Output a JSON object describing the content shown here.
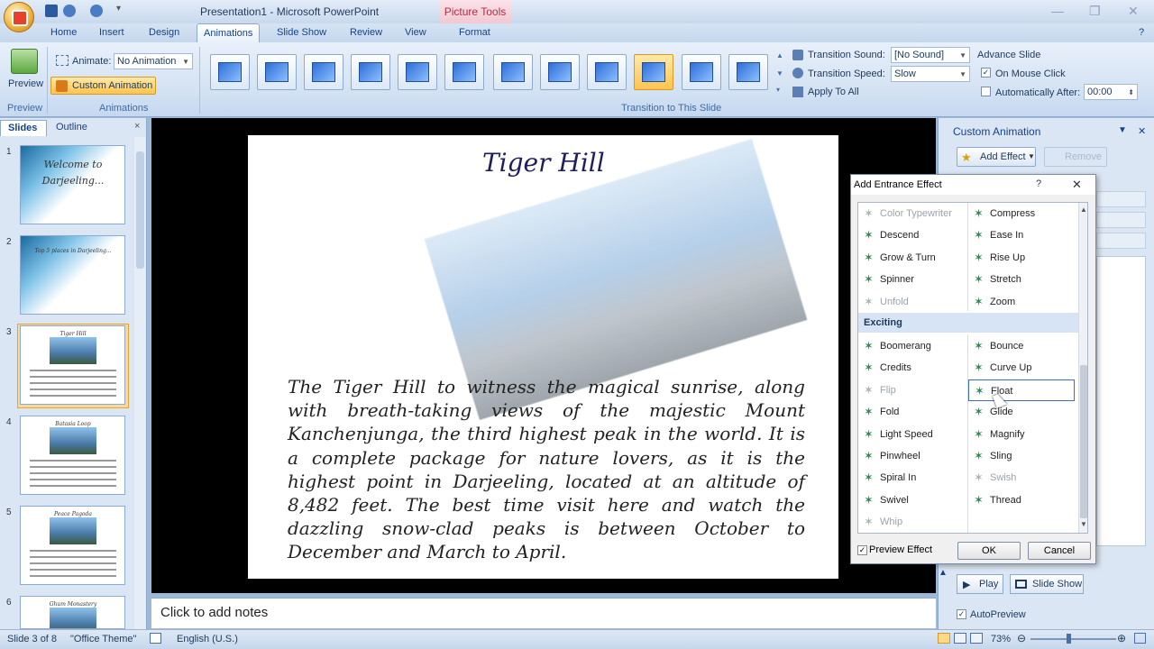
{
  "window": {
    "title": "Presentation1 - Microsoft PowerPoint",
    "contextual_tab": "Picture Tools"
  },
  "tabs": [
    "Home",
    "Insert",
    "Design",
    "Animations",
    "Slide Show",
    "Review",
    "View",
    "Format"
  ],
  "active_tab": "Animations",
  "ribbon": {
    "preview_label": "Preview",
    "preview_group": "Preview",
    "animate_label": "Animate:",
    "animate_value": "No Animation",
    "custom_animation_button": "Custom Animation",
    "animations_group": "Animations",
    "transition_group": "Transition to This Slide",
    "transition_sound_label": "Transition Sound:",
    "transition_sound_value": "[No Sound]",
    "transition_speed_label": "Transition Speed:",
    "transition_speed_value": "Slow",
    "apply_to_all": "Apply To All",
    "advance_slide": "Advance Slide",
    "on_mouse_click": "On Mouse Click",
    "on_mouse_click_checked": true,
    "automatically_after": "Automatically After:",
    "automatically_after_checked": false,
    "auto_time": "00:00",
    "selected_transition_index": 9
  },
  "left_pane": {
    "tabs": [
      "Slides",
      "Outline"
    ],
    "close": "×",
    "slides": [
      {
        "num": "1",
        "text": "Welcome to Darjeeling..."
      },
      {
        "num": "2",
        "text": "Top 5 places in Darjeeling..."
      },
      {
        "num": "3",
        "text": "Tiger Hill"
      },
      {
        "num": "4",
        "text": "Batasia Loop"
      },
      {
        "num": "5",
        "text": "Peace Pagoda"
      },
      {
        "num": "6",
        "text": "Ghum Monastery"
      }
    ],
    "selected_slide": "3"
  },
  "slide": {
    "title": "Tiger Hill",
    "body": "The Tiger Hill to witness the magical sunrise, along with breath-taking views of the majestic Mount Kanchenjunga, the third highest peak in the world. It is a complete package for nature lovers, as it is the highest point in Darjeeling, located at an altitude of 8,482 feet. The best time visit here and watch the dazzling snow-clad peaks is between October to December and March to April."
  },
  "notes_placeholder": "Click to add notes",
  "custom_animation_pane": {
    "title": "Custom Animation",
    "add_effect": "Add Effect",
    "remove": "Remove",
    "play": "Play",
    "slide_show": "Slide Show",
    "autopreview": "AutoPreview",
    "autopreview_checked": true
  },
  "dialog": {
    "title": "Add Entrance Effect",
    "help": "?",
    "close": "✕",
    "left_effects_top": [
      {
        "name": "Color Typewriter",
        "enabled": false
      },
      {
        "name": "Descend",
        "enabled": true
      },
      {
        "name": "Grow & Turn",
        "enabled": true
      },
      {
        "name": "Spinner",
        "enabled": true
      },
      {
        "name": "Unfold",
        "enabled": false
      }
    ],
    "right_effects_top": [
      {
        "name": "Compress",
        "enabled": true
      },
      {
        "name": "Ease In",
        "enabled": true
      },
      {
        "name": "Rise Up",
        "enabled": true
      },
      {
        "name": "Stretch",
        "enabled": true
      },
      {
        "name": "Zoom",
        "enabled": true
      }
    ],
    "section": "Exciting",
    "left_effects_exciting": [
      {
        "name": "Boomerang",
        "enabled": true
      },
      {
        "name": "Credits",
        "enabled": true
      },
      {
        "name": "Flip",
        "enabled": false
      },
      {
        "name": "Fold",
        "enabled": true
      },
      {
        "name": "Light Speed",
        "enabled": true
      },
      {
        "name": "Pinwheel",
        "enabled": true
      },
      {
        "name": "Spiral In",
        "enabled": true
      },
      {
        "name": "Swivel",
        "enabled": true
      },
      {
        "name": "Whip",
        "enabled": false
      }
    ],
    "right_effects_exciting": [
      {
        "name": "Bounce",
        "enabled": true
      },
      {
        "name": "Curve Up",
        "enabled": true
      },
      {
        "name": "Float",
        "enabled": true,
        "selected": true
      },
      {
        "name": "Glide",
        "enabled": true
      },
      {
        "name": "Magnify",
        "enabled": true
      },
      {
        "name": "Sling",
        "enabled": true
      },
      {
        "name": "Swish",
        "enabled": false
      },
      {
        "name": "Thread",
        "enabled": true
      }
    ],
    "preview_effect": "Preview Effect",
    "preview_effect_checked": true,
    "ok": "OK",
    "cancel": "Cancel"
  },
  "status_bar": {
    "slide_info": "Slide 3 of 8",
    "theme": "\"Office Theme\"",
    "language": "English (U.S.)",
    "zoom": "73%"
  },
  "colors": {
    "ribbon_bg": "#d2e1f3",
    "selected_orange": "#ffc44d",
    "star_green": "#2e8b57"
  }
}
